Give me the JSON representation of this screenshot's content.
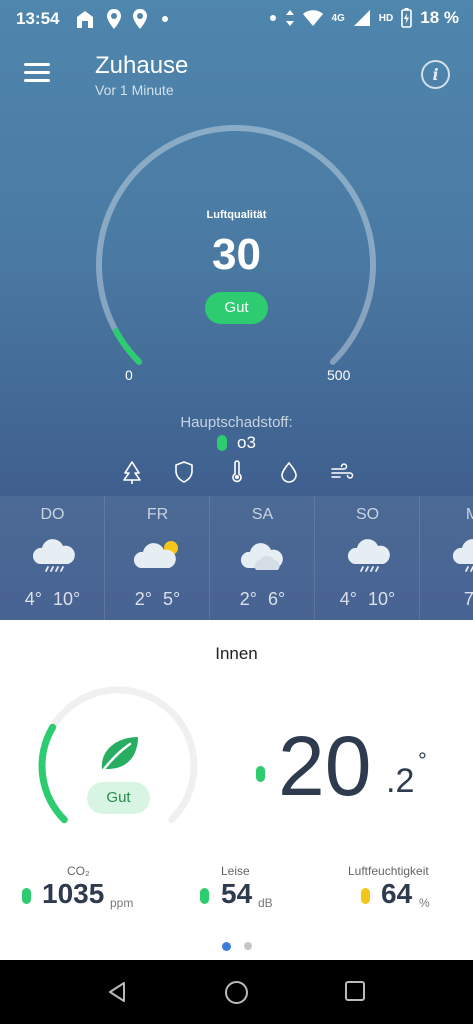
{
  "status_bar": {
    "time": "13:54",
    "battery_percent": "18 %",
    "network": "4G",
    "hd": "HD"
  },
  "header": {
    "title": "Zuhause",
    "subtitle": "Vor 1 Minute"
  },
  "air_quality": {
    "label": "Luftqualität",
    "value": "30",
    "status": "Gut",
    "scale_min": "0",
    "scale_max": "500",
    "level_fraction": 0.06,
    "accent_color": "#2ecc71"
  },
  "pollutant": {
    "label": "Hauptschadstoff:",
    "name": "o3"
  },
  "category_icons": [
    "tree-icon",
    "shield-icon",
    "thermometer-icon",
    "drop-icon",
    "wind-icon"
  ],
  "forecast": [
    {
      "day": "DO",
      "icon": "rain-cloud-icon",
      "low": "4°",
      "high": "10°"
    },
    {
      "day": "FR",
      "icon": "partly-sunny-icon",
      "low": "2°",
      "high": "5°"
    },
    {
      "day": "SA",
      "icon": "cloud-icon",
      "low": "2°",
      "high": "6°"
    },
    {
      "day": "SO",
      "icon": "rain-cloud-icon",
      "low": "4°",
      "high": "10°"
    },
    {
      "day": "M",
      "icon": "rain-cloud-icon",
      "low": "7°",
      "high": ""
    }
  ],
  "indoor": {
    "title": "Innen",
    "status": "Gut",
    "level_fraction": 0.28,
    "temperature_int": "20",
    "temperature_dec": ".2",
    "temperature_unit": "°",
    "metrics": [
      {
        "label": "CO₂",
        "value": "1035",
        "unit": "ppm",
        "color": "#2ecc71"
      },
      {
        "label": "Leise",
        "value": "54",
        "unit": "dB",
        "color": "#2ecc71"
      },
      {
        "label": "Luftfeuchtigkeit",
        "value": "64",
        "unit": "%",
        "color": "#f5c518"
      }
    ]
  },
  "pager": {
    "active": 0,
    "count": 2
  }
}
